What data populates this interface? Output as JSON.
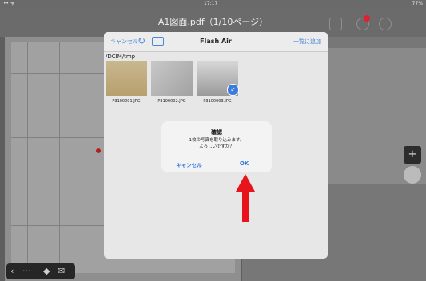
{
  "status_bar": {
    "left": "•• ᯤ",
    "time": "17:17",
    "battery": "77%"
  },
  "nav": {
    "doc_title": "A1図面.pdf（1/10ページ）"
  },
  "flashair_panel": {
    "cancel_label": "キャンセル",
    "title": "Flash Air",
    "import_all_label": "一覧に追加",
    "path": "/DCIM/tmp",
    "photos": [
      {
        "filename": "P3100001.JPG",
        "selected": false
      },
      {
        "filename": "P3100002.JPG",
        "selected": false
      },
      {
        "filename": "P3100003.JPG",
        "selected": true
      }
    ]
  },
  "dialog": {
    "title": "確認",
    "message_line1": "1枚の写真を取り込みます。",
    "message_line2": "よろしいですか？",
    "cancel_label": "キャンセル",
    "ok_label": "OK"
  },
  "colors": {
    "accent": "#2f74e0",
    "arrow": "#e8141c",
    "check": "#3a7be0"
  },
  "icons": [
    "refresh-icon",
    "camera-icon",
    "checkmark-icon",
    "back-icon",
    "more-icon",
    "eye-icon",
    "mail-icon",
    "add-icon",
    "settings-icon",
    "info-icon"
  ]
}
